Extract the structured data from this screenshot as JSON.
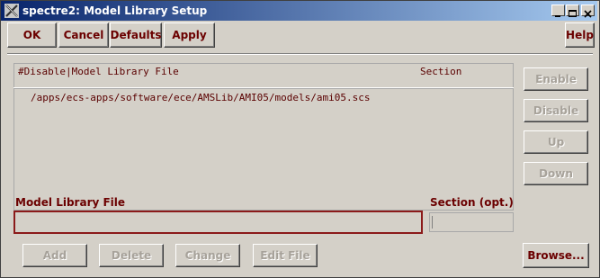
{
  "window": {
    "title": "spectre2: Model Library Setup",
    "icon": "cadence-x-icon",
    "controls": [
      "minimize-icon",
      "maximize-icon",
      "close-icon"
    ]
  },
  "toolbar": {
    "ok": "OK",
    "cancel": "Cancel",
    "defaults": "Defaults",
    "apply": "Apply",
    "help": "Help"
  },
  "list": {
    "columns": [
      "#Disable|Model Library File",
      "Section"
    ],
    "rows": [
      {
        "file": "/apps/ecs-apps/software/ece/AMSLib/AMI05/models/ami05.scs",
        "section": ""
      }
    ]
  },
  "side_buttons": {
    "enable": "Enable",
    "disable": "Disable",
    "up": "Up",
    "down": "Down"
  },
  "form": {
    "file_label": "Model Library File",
    "file_value": "",
    "section_label": "Section (opt.)",
    "section_value": ""
  },
  "bottom_buttons": {
    "add": "Add",
    "delete": "Delete",
    "change": "Change",
    "edit_file": "Edit File",
    "browse": "Browse..."
  },
  "colors": {
    "title_gradient_start": "#08246b",
    "title_gradient_end": "#a5c9ef",
    "label_text": "#6b0000",
    "field_focus_border": "#8b1a1a",
    "background": "#d4d0c8"
  }
}
